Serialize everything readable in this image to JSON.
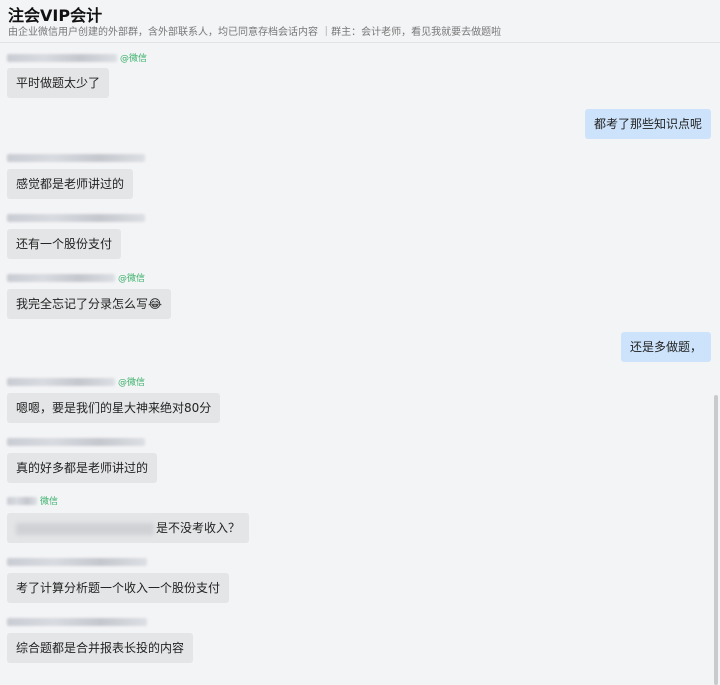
{
  "header": {
    "title": "注会VIP会计",
    "subtitle": "由企业微信用户创建的外部群，含外部联系人，均已同意存档会话内容 ｜群主：会计老师，看见我就要去做题啦"
  },
  "messages": [
    {
      "side": "left",
      "tag": "@微信",
      "text": "平时做题太少了"
    },
    {
      "side": "right",
      "text": "都考了那些知识点呢"
    },
    {
      "side": "left",
      "tag": "",
      "text": "感觉都是老师讲过的"
    },
    {
      "side": "left",
      "tag": "",
      "text": "还有一个股份支付"
    },
    {
      "side": "left",
      "tag": "@微信",
      "text": "我完全忘记了分录怎么写😂"
    },
    {
      "side": "right",
      "text": "还是多做题，"
    },
    {
      "side": "left",
      "tag": "@微信",
      "text": "嗯嗯，要是我们的星大神来绝对80分"
    },
    {
      "side": "left",
      "tag": "",
      "text": "真的好多都是老师讲过的"
    },
    {
      "side": "left",
      "tag": "微信",
      "text": "是不没考收入？"
    },
    {
      "side": "left",
      "tag": "",
      "text": "考了计算分析题一个收入一个股份支付"
    },
    {
      "side": "left",
      "tag": "",
      "text": "综合题都是合并报表长投的内容"
    }
  ]
}
